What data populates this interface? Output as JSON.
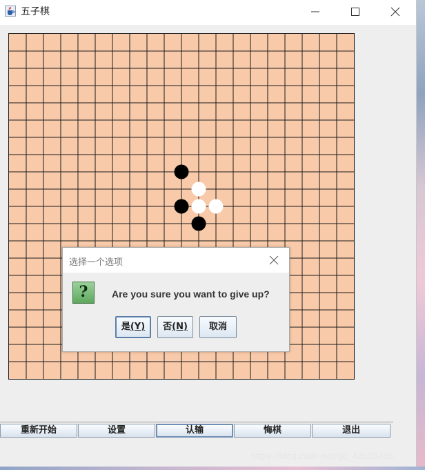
{
  "window": {
    "title": "五子棋",
    "controls": {
      "minimize_icon": "minimize-icon",
      "maximize_icon": "maximize-icon",
      "close_icon": "close-icon"
    }
  },
  "board": {
    "lines": 20,
    "colors": {
      "background": "#f9caa9",
      "grid": "#1a1a1a"
    },
    "stones": [
      {
        "color": "black",
        "col": 10,
        "row": 8
      },
      {
        "color": "white",
        "col": 11,
        "row": 9
      },
      {
        "color": "black",
        "col": 10,
        "row": 10
      },
      {
        "color": "white",
        "col": 11,
        "row": 10
      },
      {
        "color": "white",
        "col": 12,
        "row": 10
      },
      {
        "color": "black",
        "col": 11,
        "row": 11
      }
    ]
  },
  "dialog": {
    "title": "选择一个选项",
    "message": "Are you sure you want to give up?",
    "icon": "question-icon",
    "buttons": {
      "yes": {
        "text": "是",
        "mnemonic": "(Y)"
      },
      "no": {
        "text": "否",
        "mnemonic": "(N)"
      },
      "cancel": {
        "text": "取消"
      }
    }
  },
  "toolbar": {
    "buttons": [
      "重新开始",
      "设置",
      "认输",
      "悔棋",
      "退出"
    ]
  },
  "watermark": "https://blog.csdn.net/qq_43533435"
}
